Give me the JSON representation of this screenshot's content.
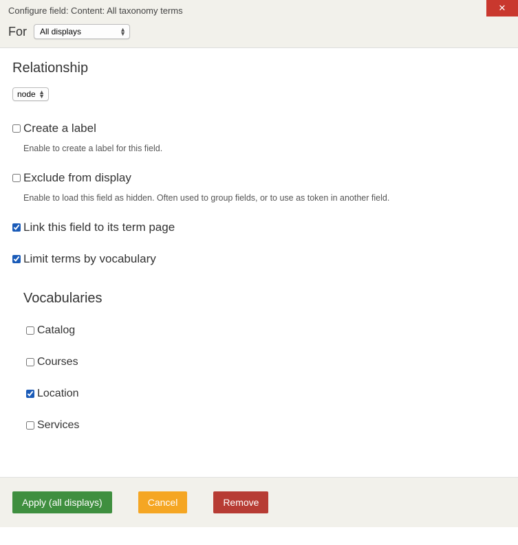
{
  "header": {
    "title": "Configure field: Content: All taxonomy terms",
    "for_label": "For",
    "for_select": "All displays"
  },
  "relationship": {
    "heading": "Relationship",
    "value": "node"
  },
  "options": {
    "create_label": {
      "label": "Create a label",
      "help": "Enable to create a label for this field.",
      "checked": false
    },
    "exclude_display": {
      "label": "Exclude from display",
      "help": "Enable to load this field as hidden. Often used to group fields, or to use as token in another field.",
      "checked": false
    },
    "link_term": {
      "label": "Link this field to its term page",
      "checked": true
    },
    "limit_vocab": {
      "label": "Limit terms by vocabulary",
      "checked": true
    }
  },
  "vocabularies": {
    "heading": "Vocabularies",
    "items": [
      {
        "label": "Catalog",
        "checked": false
      },
      {
        "label": "Courses",
        "checked": false
      },
      {
        "label": "Location",
        "checked": true
      },
      {
        "label": "Services",
        "checked": false
      }
    ]
  },
  "footer": {
    "apply": "Apply (all displays)",
    "cancel": "Cancel",
    "remove": "Remove"
  }
}
